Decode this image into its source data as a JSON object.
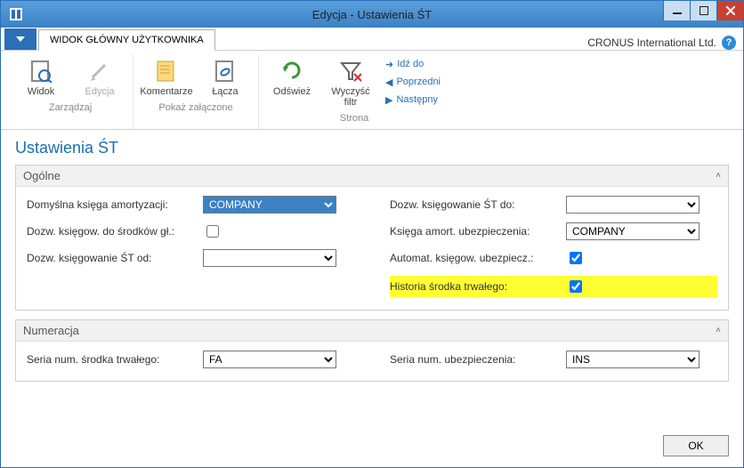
{
  "window": {
    "title": "Edycja - Ustawienia ŚT",
    "company": "CRONUS International Ltd."
  },
  "tabs": {
    "main": "WIDOK GŁÓWNY UŻYTKOWNIKA"
  },
  "ribbon": {
    "zarzadzaj": {
      "label": "Zarządzaj",
      "widok": "Widok",
      "edycja": "Edycja"
    },
    "pokaz": {
      "label": "Pokaż załączone",
      "komentarze": "Komentarze",
      "lacza": "Łącza"
    },
    "strona": {
      "label": "Strona",
      "odswiez": "Odśwież",
      "wyczysc": "Wyczyść filtr",
      "idz": "Idź do",
      "poprzedni": "Poprzedni",
      "nastepny": "Następny"
    }
  },
  "page": {
    "title": "Ustawienia ŚT"
  },
  "ogolne": {
    "header": "Ogólne",
    "domyslna_ksiega_label": "Domyślna księga amortyzacji:",
    "domyslna_ksiega_value": "COMPANY",
    "dozw_ksiegow_do_srodkow_label": "Dozw. księgow. do środków gł.:",
    "dozw_ksiegow_do_srodkow_value": false,
    "dozw_ksiegowanie_od_label": "Dozw. księgowanie ŚT od:",
    "dozw_ksiegowanie_od_value": "",
    "dozw_ksiegowanie_do_label": "Dozw. księgowanie ŚT do:",
    "dozw_ksiegowanie_do_value": "",
    "ksiega_amort_ubezp_label": "Księga amort. ubezpieczenia:",
    "ksiega_amort_ubezp_value": "COMPANY",
    "automat_ksiegow_ubezp_label": "Automat. księgow. ubezpiecz.:",
    "automat_ksiegow_ubezp_value": true,
    "historia_label": "Historia środka trwałego:",
    "historia_value": true
  },
  "numeracja": {
    "header": "Numeracja",
    "seria_st_label": "Seria num. środka trwałego:",
    "seria_st_value": "FA",
    "seria_ubezp_label": "Seria num. ubezpieczenia:",
    "seria_ubezp_value": "INS"
  },
  "footer": {
    "ok": "OK"
  }
}
